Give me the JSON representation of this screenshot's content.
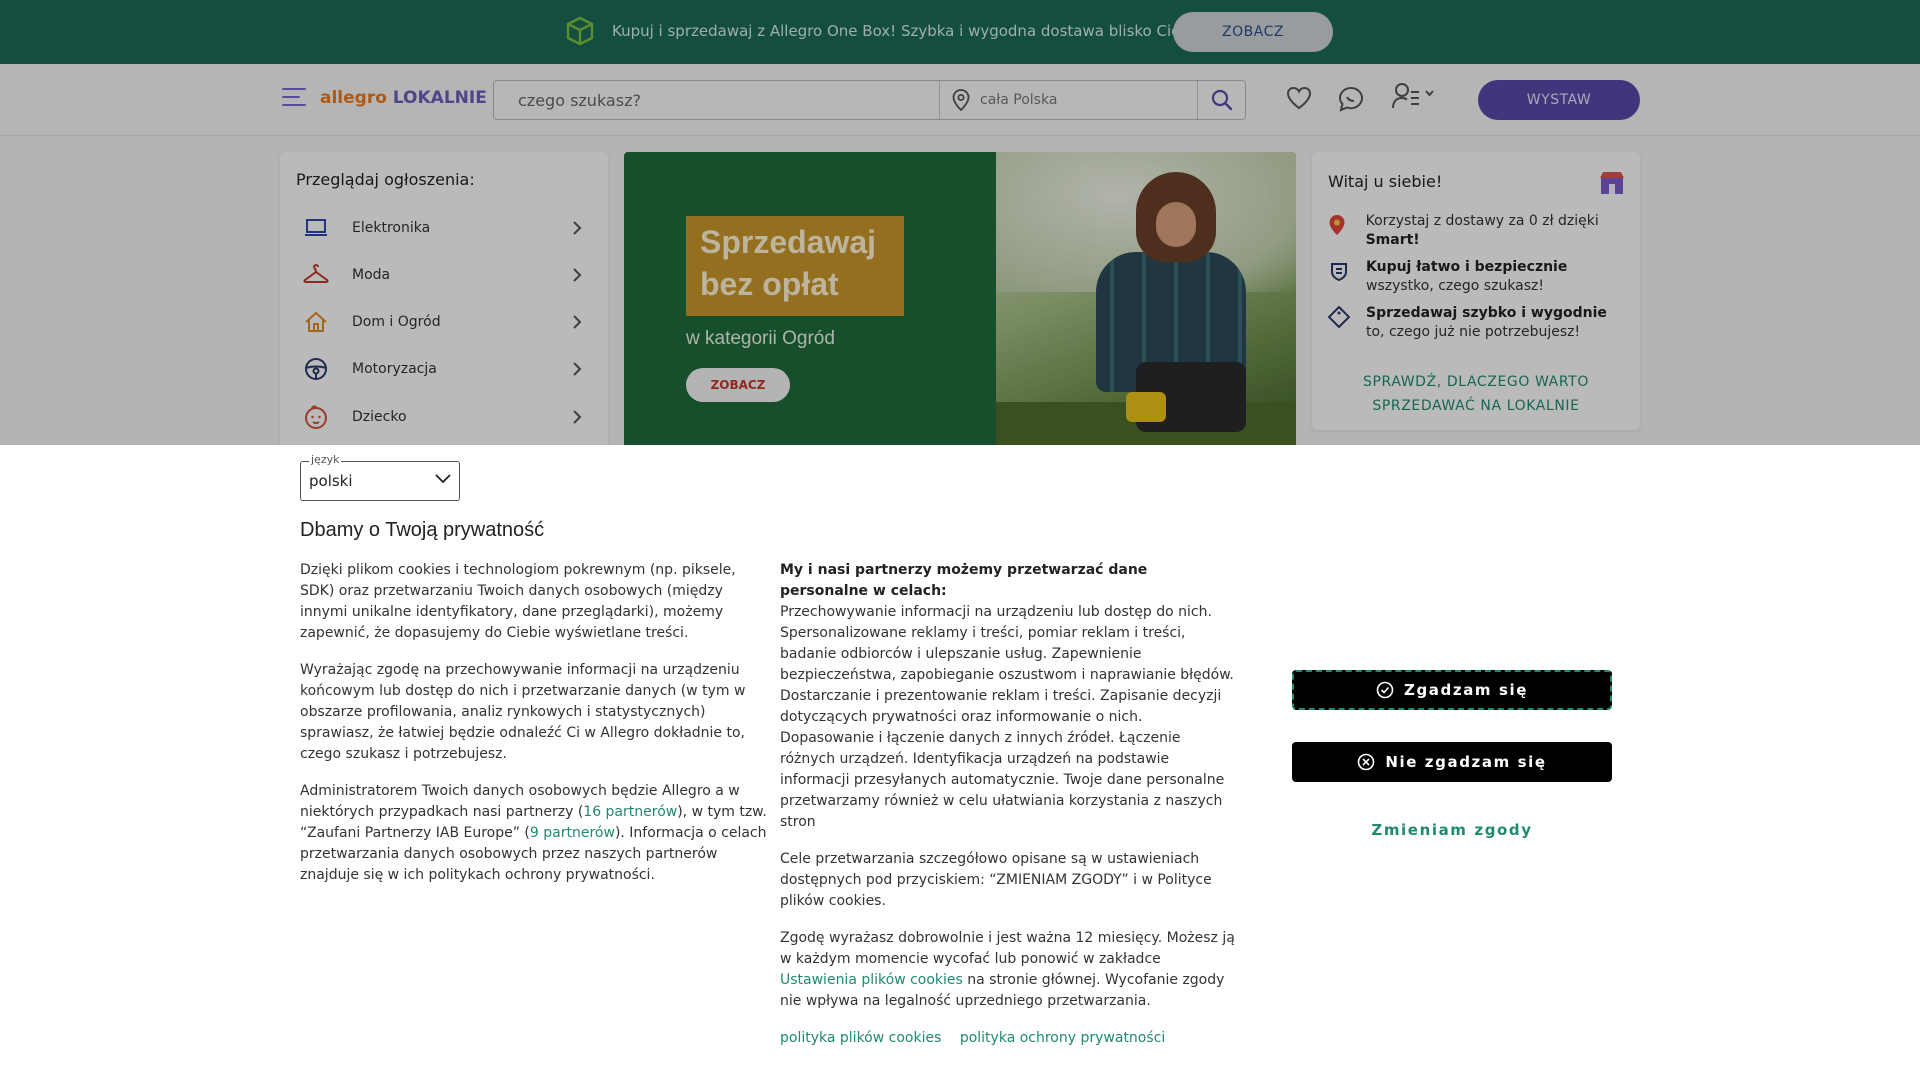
{
  "promo": {
    "text": "Kupuj i sprzedawaj z Allegro One Box! Szybka i wygodna dostawa blisko Ciebie",
    "button": "ZOBACZ"
  },
  "header": {
    "logo_part1": "allegro",
    "logo_part2": "LOKALNIE",
    "search_placeholder": "czego szukasz?",
    "location_placeholder": "cała Polska",
    "post_button": "WYSTAW"
  },
  "categories": {
    "title": "Przeglądaj ogłoszenia:",
    "items": [
      {
        "label": "Elektronika",
        "icon": "laptop-icon"
      },
      {
        "label": "Moda",
        "icon": "hanger-icon"
      },
      {
        "label": "Dom i Ogród",
        "icon": "house-icon"
      },
      {
        "label": "Motoryzacja",
        "icon": "steering-wheel-icon"
      },
      {
        "label": "Dziecko",
        "icon": "baby-icon"
      }
    ]
  },
  "hero": {
    "line1": "Sprzedawaj",
    "line2": "bez opłat",
    "subtitle": "w kategorii Ogród",
    "cta": "ZOBACZ"
  },
  "welcome": {
    "title": "Witaj u siebie!",
    "item1_pre": "Korzystaj z dostawy za 0 zł dzięki ",
    "item1_bold": "Smart!",
    "item2_bold": "Kupuj łatwo i bezpiecznie",
    "item2_post": " wszystko, czego szukasz!",
    "item3_bold": "Sprzedawaj szybko i wygodnie",
    "item3_post": " to, czego już nie potrzebujesz!",
    "more_link": "SPRAWDŹ, DLACZEGO WARTO SPRZEDAWAĆ NA LOKALNIE"
  },
  "consent": {
    "lang_legend": "język",
    "lang_value": "polski",
    "title": "Dbamy o Twoją prywatność",
    "col1_p1": "Dzięki plikom cookies i technologiom pokrewnym (np. piksele, SDK) oraz przetwarzaniu Twoich danych osobowych (między innymi unikalne identyfikatory, dane przeglądarki), możemy zapewnić, że dopasujemy do Ciebie wyświetlane treści.",
    "col1_p2": "Wyrażając zgodę na przechowywanie informacji na urządzeniu końcowym lub dostęp do nich i przetwarzanie danych (w tym w obszarze profilowania, analiz rynkowych i statystycznych) sprawiasz, że łatwiej będzie odnaleźć Ci w Allegro dokładnie to, czego szukasz i potrzebujesz.",
    "col1_p3_a": "Administratorem Twoich danych osobowych będzie Allegro a w niektórych przypadkach nasi partnerzy (",
    "col1_p3_link1": "16 partnerów",
    "col1_p3_b": "), w tym tzw. “Zaufani Partnerzy IAB Europe” (",
    "col1_p3_link2": "9 partnerów",
    "col1_p3_c": "). Informacja o celach przetwarzania danych osobowych przez naszych partnerów znajduje się w ich politykach ochrony prywatności.",
    "col2_head": "My i nasi partnerzy możemy przetwarzać dane personalne w celach:",
    "col2_p1": "Przechowywanie informacji na urządzeniu lub dostęp do nich. Spersonalizowane reklamy i treści, pomiar reklam i treści, badanie odbiorców i ulepszanie usług. Zapewnienie bezpieczeństwa, zapobieganie oszustwom i naprawianie błędów. Dostarczanie i prezentowanie reklam i treści. Zapisanie decyzji dotyczących prywatności oraz informowanie o nich. Dopasowanie i łączenie danych z innych źródeł. Łączenie różnych urządzeń. Identyfikacja urządzeń na podstawie informacji przesyłanych automatycznie. Twoje dane personalne przetwarzamy również w celu ułatwiania korzystania z naszych stron",
    "col2_p2": "Cele przetwarzania szczegółowo opisane są w ustawieniach dostępnych pod przyciskiem: “ZMIENIAM ZGODY” i w Polityce plików cookies.",
    "col2_p3_a": "Zgodę wyrażasz dobrowolnie i jest ważna 12 miesięcy. Możesz ją w każdym momencie wycofać lub ponowić w zakładce ",
    "col2_p3_link": "Ustawienia plików cookies",
    "col2_p3_b": " na stronie głównej. Wycofanie zgody nie wpływa na legalność uprzedniego przetwarzania.",
    "policy_cookies": "polityka plików cookies",
    "policy_privacy": "polityka ochrony prywatności",
    "btn_agree": "Zgadzam się",
    "btn_disagree": "Nie zgadzam się",
    "btn_change": "Zmieniam zgody"
  },
  "colors": {
    "promo_bg": "#1b6a58",
    "accent_purple": "#5a48a8",
    "link_green": "#1f8a70",
    "logo_orange": "#e87a1e"
  }
}
